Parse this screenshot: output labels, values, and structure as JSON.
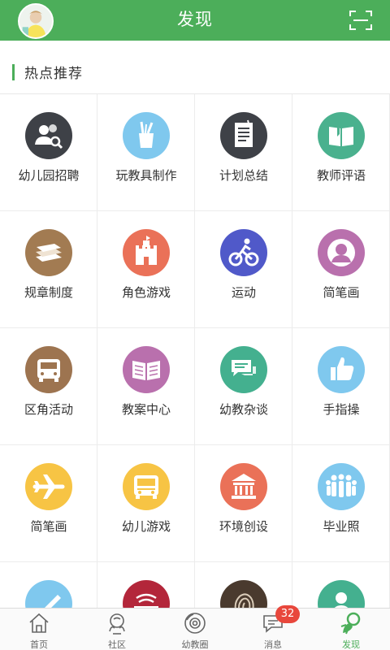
{
  "header": {
    "title": "发现"
  },
  "section": {
    "title": "热点推荐"
  },
  "grid_items": [
    {
      "label": "幼儿园招聘",
      "icon": "people-search-icon",
      "color": "#3e4147"
    },
    {
      "label": "玩教具制作",
      "icon": "pencil-cup-icon",
      "color": "#7fc8ee"
    },
    {
      "label": "计划总结",
      "icon": "document-icon",
      "color": "#3e4147"
    },
    {
      "label": "教师评语",
      "icon": "book-bookmark-icon",
      "color": "#4ab18e"
    },
    {
      "label": "规章制度",
      "icon": "book-stack-icon",
      "color": "#a27b52"
    },
    {
      "label": "角色游戏",
      "icon": "castle-icon",
      "color": "#ea7158"
    },
    {
      "label": "运动",
      "icon": "cyclist-icon",
      "color": "#5059c9"
    },
    {
      "label": "简笔画",
      "icon": "portrait-icon",
      "color": "#b970ad"
    },
    {
      "label": "区角活动",
      "icon": "bus-icon",
      "color": "#9d7450"
    },
    {
      "label": "教案中心",
      "icon": "open-book-icon",
      "color": "#b970ad"
    },
    {
      "label": "幼教杂谈",
      "icon": "chat-bubbles-icon",
      "color": "#44b08f"
    },
    {
      "label": "手指操",
      "icon": "thumbs-up-icon",
      "color": "#7fc8ee"
    },
    {
      "label": "简笔画",
      "icon": "airplane-icon",
      "color": "#f7c444"
    },
    {
      "label": "幼儿游戏",
      "icon": "school-bus-icon",
      "color": "#f7c444"
    },
    {
      "label": "环境创设",
      "icon": "building-icon",
      "color": "#ea7158"
    },
    {
      "label": "毕业照",
      "icon": "group-photo-icon",
      "color": "#7fc8ee"
    },
    {
      "label": "",
      "icon": "pen-icon",
      "color": "#7fc8ee"
    },
    {
      "label": "",
      "icon": "wifi-card-icon",
      "color": "#b3263a"
    },
    {
      "label": "",
      "icon": "fingerprint-icon",
      "color": "#4a3a2e"
    },
    {
      "label": "",
      "icon": "person-icon",
      "color": "#44b08f"
    }
  ],
  "bottom_nav": [
    {
      "label": "首页",
      "icon": "home-icon"
    },
    {
      "label": "社区",
      "icon": "community-icon"
    },
    {
      "label": "幼教圈",
      "icon": "camera-circle-icon"
    },
    {
      "label": "消息",
      "icon": "message-icon",
      "badge": "32"
    },
    {
      "label": "发现",
      "icon": "discover-rocket-icon",
      "active": true
    }
  ],
  "colors": {
    "primary": "#4cae5a",
    "badge": "#e8473c"
  }
}
